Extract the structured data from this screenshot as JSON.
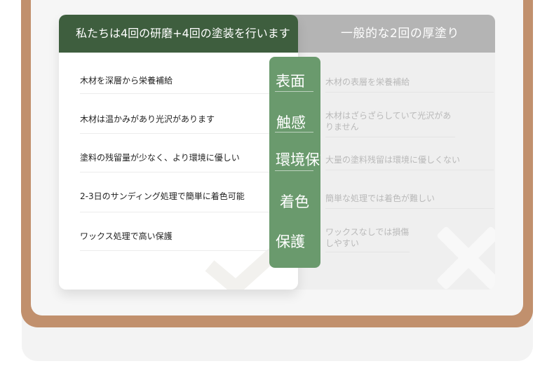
{
  "compare": {
    "left": {
      "title": "私たちは4回の研磨+4回の塗装を行います",
      "items": [
        "木材を深層から栄養補給",
        "木材は温かみがあり光沢があります",
        "塗料の残留量が少なく、より環境に優しい",
        "2-3日のサンディング処理で簡単に着色可能",
        "ワックス処理で高い保護"
      ],
      "mark_icon": "check-icon"
    },
    "right": {
      "title": "一般的な2回の厚塗り",
      "items": [
        "木材の表層を栄養補給",
        "木材はざらざらしていて光沢がありません",
        "大量の塗料残留は環境に優しくない",
        "簡単な処理では着色が難しい",
        "ワックスなしでは損傷しやすい"
      ],
      "mark_icon": "cross-icon"
    },
    "categories": [
      "表面",
      "触感",
      "環境保護",
      "着色",
      "保護"
    ]
  },
  "colors": {
    "frame": "#c1906d",
    "left_header": "#3e5e3e",
    "pill": "#6a9a6d",
    "right_header": "#b4b4b4"
  }
}
